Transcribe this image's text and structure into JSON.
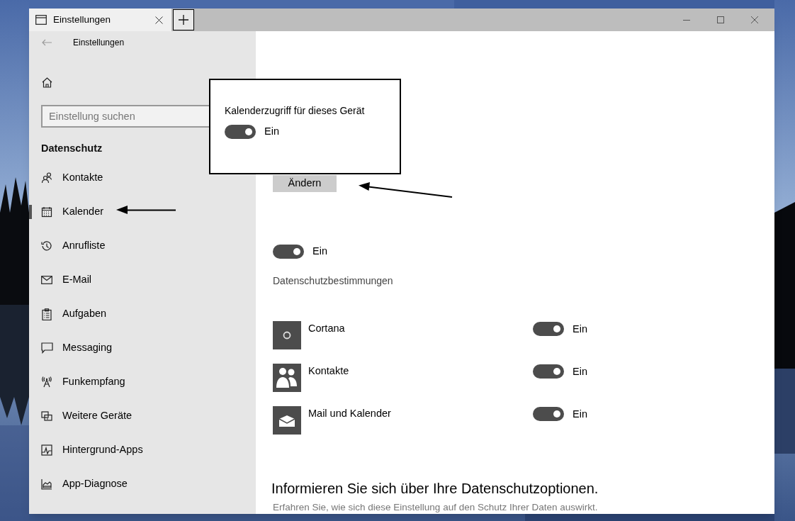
{
  "window": {
    "tab_title": "Einstellungen",
    "app_title": "Einstellungen"
  },
  "sidebar": {
    "search": {
      "placeholder": "Einstellung suchen"
    },
    "section": "Datenschutz",
    "items": [
      {
        "label": "Kontakte",
        "selected": false
      },
      {
        "label": "Kalender",
        "selected": true
      },
      {
        "label": "Anrufliste",
        "selected": false
      },
      {
        "label": "E-Mail",
        "selected": false
      },
      {
        "label": "Aufgaben",
        "selected": false
      },
      {
        "label": "Messaging",
        "selected": false
      },
      {
        "label": "Funkempfang",
        "selected": false
      },
      {
        "label": "Weitere Geräte",
        "selected": false
      },
      {
        "label": "Hintergrund-Apps",
        "selected": false
      },
      {
        "label": "App-Diagnose",
        "selected": false
      }
    ]
  },
  "callout": {
    "label": "Kalenderzugriff für dieses Gerät",
    "toggle": {
      "on": true,
      "text": "Ein"
    }
  },
  "content": {
    "change_button": "Ändern",
    "toggle": {
      "on": true,
      "text": "Ein"
    },
    "privacy_link": "Datenschutzbestimmungen",
    "apps": [
      {
        "name": "Cortana",
        "on": true,
        "text": "Ein"
      },
      {
        "name": "Kontakte",
        "on": true,
        "text": "Ein"
      },
      {
        "name": "Mail und Kalender",
        "on": true,
        "text": "Ein"
      }
    ],
    "info_heading": "Informieren Sie sich über Ihre Datenschutzoptionen.",
    "info_text": "Erfahren Sie, wie sich diese Einstellung auf den Schutz Ihrer Daten auswirkt."
  }
}
